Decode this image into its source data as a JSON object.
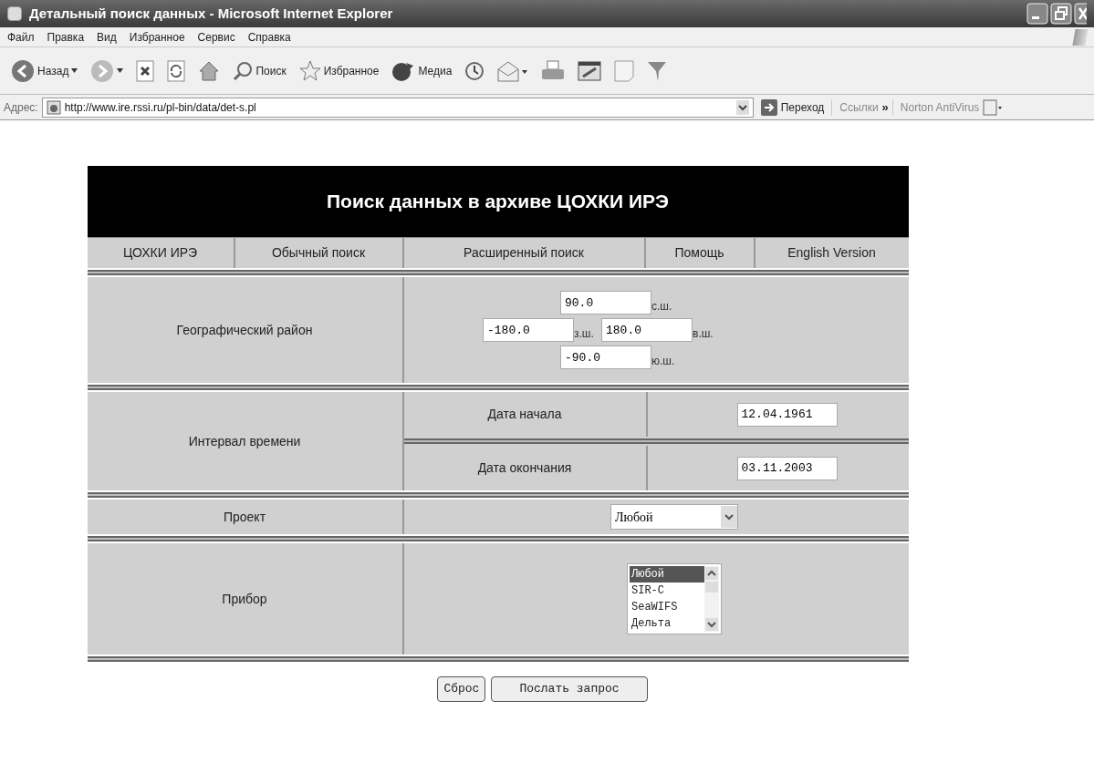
{
  "window": {
    "title": "Детальный поиск данных - Microsoft Internet Explorer"
  },
  "menu": [
    "Файл",
    "Правка",
    "Вид",
    "Избранное",
    "Сервис",
    "Справка"
  ],
  "toolbar": [
    {
      "kind": "back",
      "label": "Назад"
    },
    {
      "kind": "forward"
    },
    {
      "kind": "stop"
    },
    {
      "kind": "refresh"
    },
    {
      "kind": "home"
    },
    {
      "kind": "search",
      "label": "Поиск"
    },
    {
      "kind": "favorites",
      "label": "Избранное"
    },
    {
      "kind": "media",
      "label": "Медиа"
    },
    {
      "kind": "history"
    },
    {
      "kind": "mail"
    },
    {
      "kind": "print"
    },
    {
      "kind": "edit"
    },
    {
      "kind": "page"
    },
    {
      "kind": "filter"
    }
  ],
  "address": {
    "label": "Адрес:",
    "value": "http://www.ire.rssi.ru/pl-bin/data/det-s.pl",
    "go": "Переход",
    "links": "Ссылки",
    "chevron": "»",
    "extension": "Norton AntiVirus"
  },
  "page": {
    "heading": "Поиск данных в архиве ЦОХКИ ИРЭ",
    "nav": [
      "ЦОХКИ ИРЭ",
      "Обычный поиск",
      "Расширенный поиск",
      "Помощь",
      "English Version"
    ],
    "geo": {
      "label": "Географический район",
      "north": {
        "value": "90.0",
        "unit": "с.ш."
      },
      "west": {
        "value": "-180.0",
        "unit": "з.ш."
      },
      "east": {
        "value": "180.0",
        "unit": "в.ш."
      },
      "south": {
        "value": "-90.0",
        "unit": "ю.ш."
      }
    },
    "time": {
      "label": "Интервал времени",
      "start": {
        "label": "Дата начала",
        "value": "12.04.1961"
      },
      "end": {
        "label": "Дата окончания",
        "value": "03.11.2003"
      }
    },
    "project": {
      "label": "Проект",
      "value": "Любой"
    },
    "device": {
      "label": "Прибор",
      "options": [
        {
          "text": "Любой",
          "selected": true
        },
        {
          "text": "SIR-C",
          "selected": false
        },
        {
          "text": "SeaWIFS",
          "selected": false
        },
        {
          "text": "Дельта",
          "selected": false
        }
      ]
    },
    "buttons": [
      "Сброс",
      "Послать запрос"
    ]
  }
}
